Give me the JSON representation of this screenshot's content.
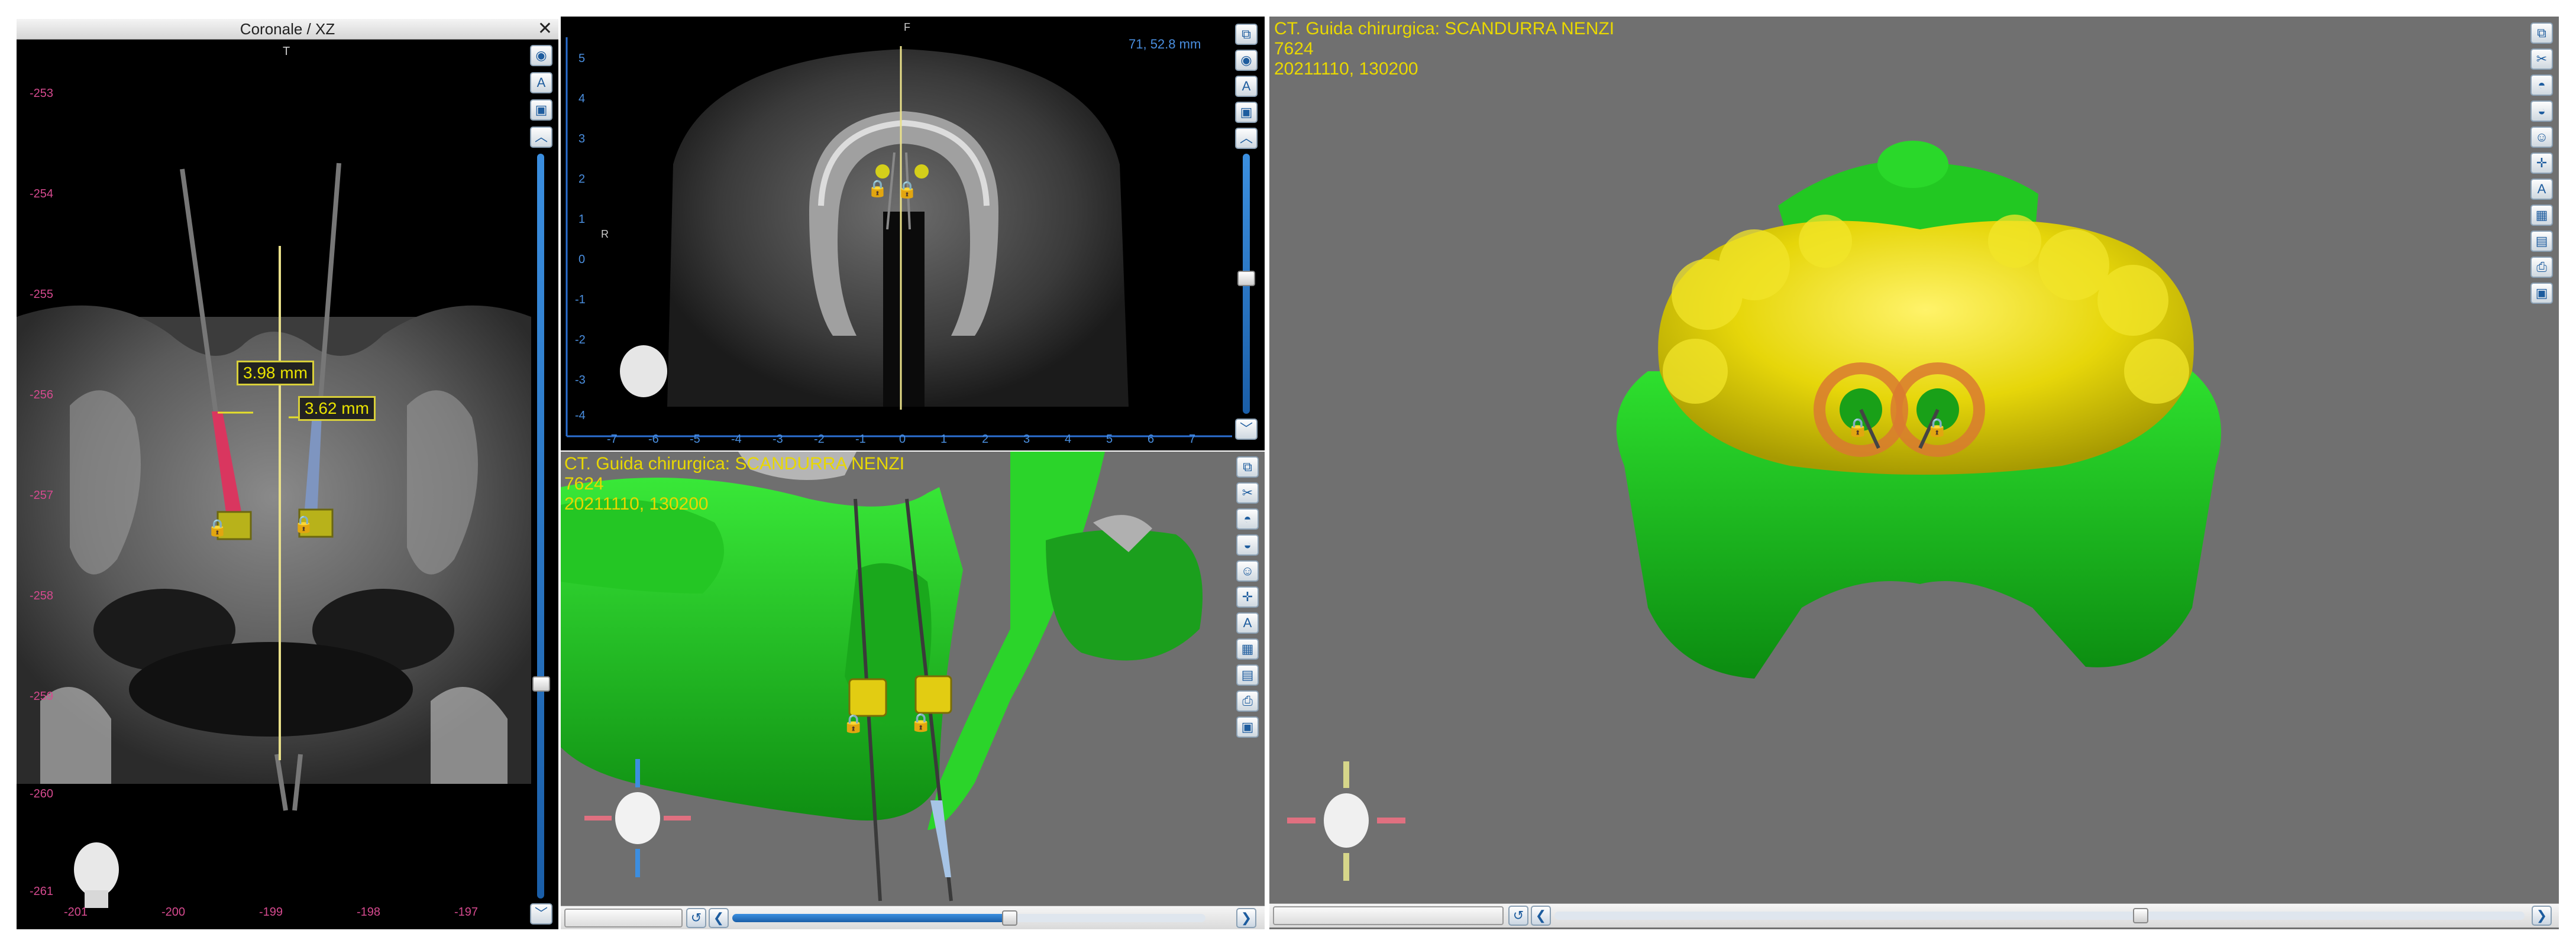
{
  "coronal": {
    "title": "Coronale / XZ",
    "top_marker": "T",
    "y_labels": [
      "-253",
      "-254",
      "-255",
      "-256",
      "-257",
      "-258",
      "-259",
      "-260",
      "-261"
    ],
    "x_labels": [
      "-201",
      "-200",
      "-199",
      "-198",
      "-197"
    ],
    "measure_left": "3.98 mm",
    "measure_right": "3.62 mm"
  },
  "axial": {
    "top_marker": "F",
    "distance": "71, 52.8 mm",
    "side_marker": "R",
    "y_labels": [
      "5",
      "4",
      "3",
      "2",
      "1",
      "0",
      "-1",
      "-2",
      "-3",
      "-4"
    ],
    "x_labels": [
      "-7",
      "-6",
      "-5",
      "-4",
      "-3",
      "-2",
      "-1",
      "0",
      "1",
      "2",
      "3",
      "4",
      "5",
      "6",
      "7"
    ]
  },
  "view3d_small": {
    "line1": "CT. Guida chirurgica: SCANDURRA NENZI",
    "line2": "7624",
    "line3": "20211110, 130200"
  },
  "view3d_large": {
    "line1": "CT. Guida chirurgica: SCANDURRA NENZI",
    "line2": "7624",
    "line3": "20211110, 130200"
  },
  "icons": {
    "close": "✕",
    "arrow_left": "❮",
    "arrow_right": "❯",
    "arrow_up": "︿",
    "arrow_down": "﹀"
  },
  "colors": {
    "overlay_text": "#e9d800",
    "measure_pink": "#d64a8f",
    "model_green": "#18c31a",
    "guide_yellow": "#e8e000"
  }
}
